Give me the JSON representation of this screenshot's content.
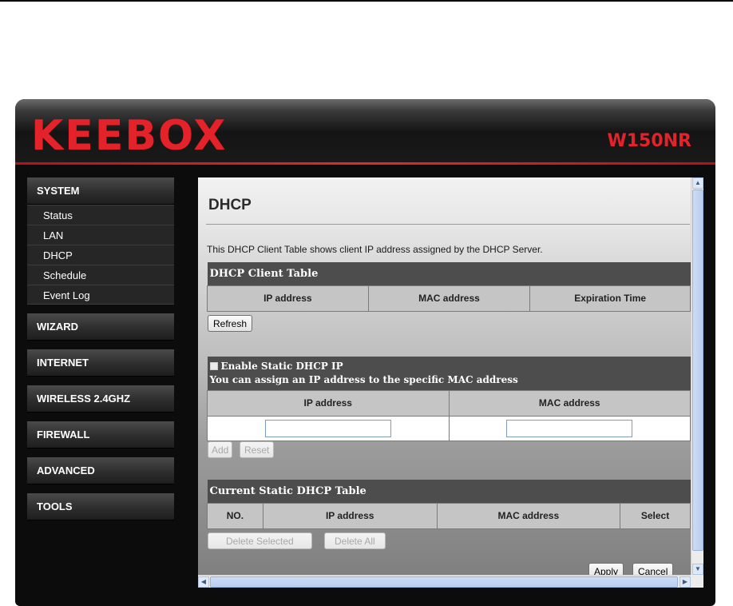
{
  "brand": {
    "logo": "KEEBOX",
    "model": "W150NR"
  },
  "sidebar": {
    "system": "SYSTEM",
    "system_items": [
      "Status",
      "LAN",
      "DHCP",
      "Schedule",
      "Event Log"
    ],
    "wizard": "WIZARD",
    "internet": "INTERNET",
    "wireless": "WIRELESS 2.4GHZ",
    "firewall": "FIREWALL",
    "advanced": "ADVANCED",
    "tools": "TOOLS"
  },
  "page": {
    "title": "DHCP",
    "description": "This DHCP Client Table shows client IP address assigned by the DHCP Server."
  },
  "client_table": {
    "title": "DHCP Client Table",
    "columns": [
      "IP address",
      "MAC address",
      "Expiration Time"
    ],
    "rows": [],
    "refresh_label": "Refresh"
  },
  "static_section": {
    "enable_label": "Enable Static DHCP IP",
    "enabled": false,
    "subtitle": "You can assign an IP address to the specific MAC address",
    "columns": [
      "IP address",
      "MAC address"
    ],
    "ip_value": "",
    "mac_value": "",
    "add_label": "Add",
    "reset_label": "Reset"
  },
  "current_table": {
    "title": "Current Static DHCP Table",
    "columns": [
      "NO.",
      "IP address",
      "MAC address",
      "Select"
    ],
    "rows": [],
    "delete_selected_label": "Delete Selected",
    "delete_all_label": "Delete All"
  },
  "footer": {
    "apply_label": "Apply",
    "cancel_label": "Cancel"
  },
  "colors": {
    "brand_red": "#e4222a",
    "panel_dark": "#4d4d4d",
    "background_dark": "#0c0c0c"
  }
}
